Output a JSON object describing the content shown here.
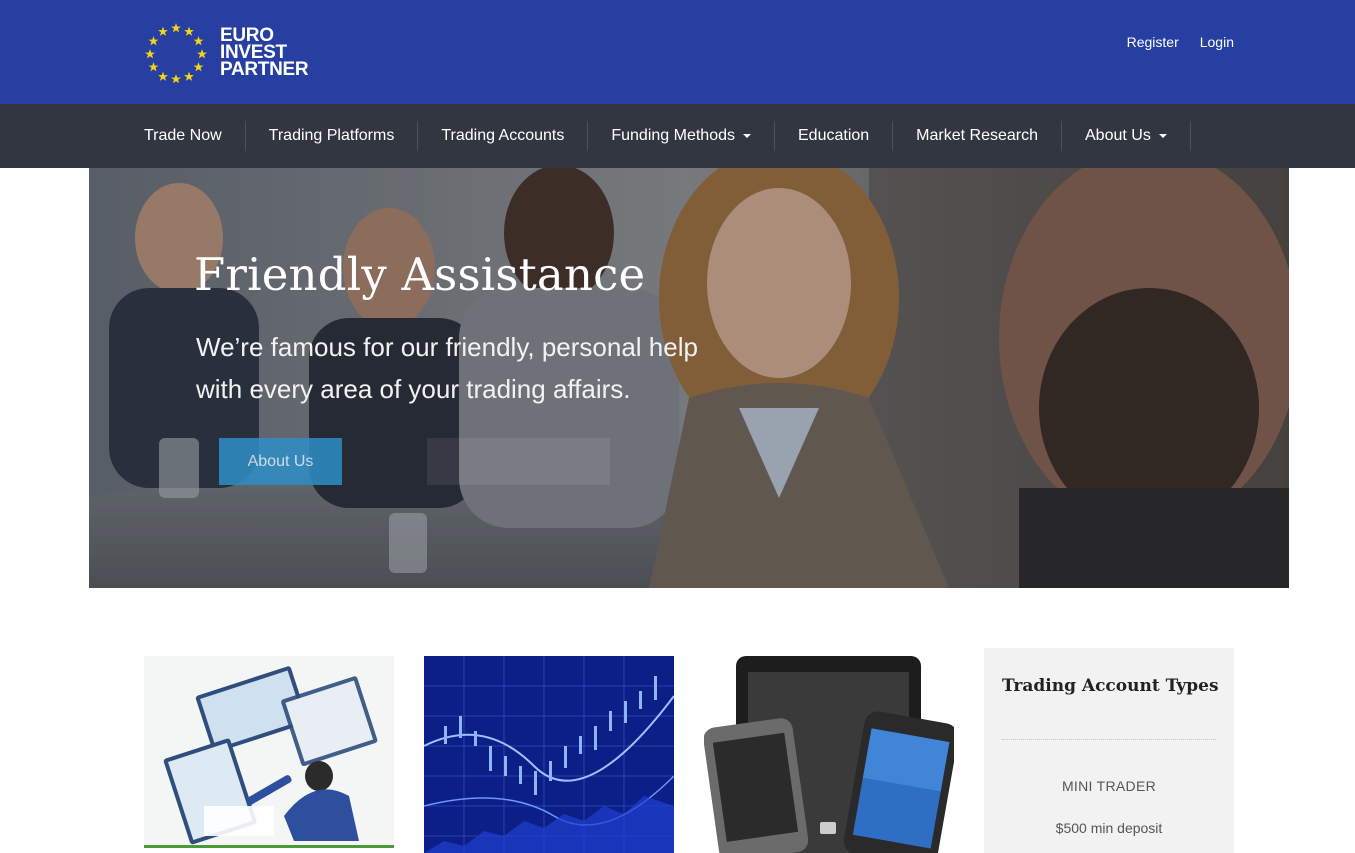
{
  "brand": {
    "logo_line1": "EURO",
    "logo_line2": "INVEST",
    "logo_line3": "PARTNER"
  },
  "auth": {
    "register": "Register",
    "login": "Login"
  },
  "nav": {
    "items": [
      {
        "label": "Trade Now"
      },
      {
        "label": "Trading Platforms"
      },
      {
        "label": "Trading Accounts"
      },
      {
        "label": "Funding Methods"
      },
      {
        "label": "Education"
      },
      {
        "label": "Market Research"
      },
      {
        "label": "About Us"
      }
    ]
  },
  "hero": {
    "title": "Friendly Assistance",
    "subtitle": "We’re famous for our friendly, personal help with every area of your trading affairs.",
    "button_label": "About Us"
  },
  "account_panel": {
    "title": "Trading Account Types",
    "account_name": "MINI TRADER",
    "deposit": "$500 min deposit"
  },
  "colors": {
    "header_blue": "#263fa0",
    "nav_dark": "#323640",
    "button_blue": "#2e8ec7",
    "star_yellow": "#f6d417"
  }
}
